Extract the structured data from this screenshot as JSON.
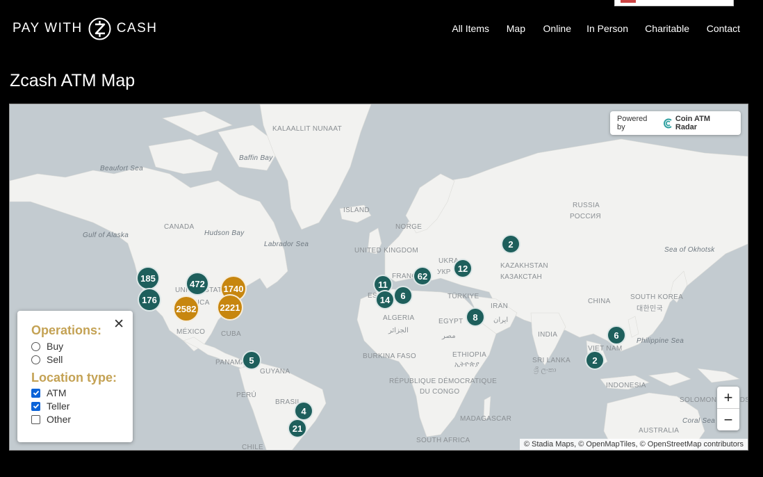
{
  "header": {
    "logo_left": "PAY WITH",
    "logo_right": "CASH",
    "nav": [
      {
        "label": "All Items"
      },
      {
        "label": "Map"
      },
      {
        "label": "Online"
      },
      {
        "label": "In Person"
      },
      {
        "label": "Charitable"
      },
      {
        "label": "Contact"
      }
    ]
  },
  "page": {
    "title": "Zcash ATM Map"
  },
  "map": {
    "powered_by": "Powered by",
    "provider": "Coin ATM Radar",
    "attribution": "© Stadia Maps, © OpenMapTiles, © OpenStreetMap contributors",
    "zoom_in": "+",
    "zoom_out": "−",
    "colors": {
      "cluster_teal": "#1e5f5c",
      "cluster_gold": "#c7860f",
      "water": "#c3cbd0",
      "land": "#f2f2f0"
    },
    "clusters": [
      {
        "count": "185",
        "color": "teal"
      },
      {
        "count": "176",
        "color": "teal"
      },
      {
        "count": "472",
        "color": "teal"
      },
      {
        "count": "1740",
        "color": "gold"
      },
      {
        "count": "2582",
        "color": "gold"
      },
      {
        "count": "2221",
        "color": "gold"
      },
      {
        "count": "5",
        "color": "teal"
      },
      {
        "count": "4",
        "color": "teal"
      },
      {
        "count": "21",
        "color": "teal"
      },
      {
        "count": "11",
        "color": "teal"
      },
      {
        "count": "14",
        "color": "teal"
      },
      {
        "count": "6",
        "color": "teal"
      },
      {
        "count": "62",
        "color": "teal"
      },
      {
        "count": "12",
        "color": "teal"
      },
      {
        "count": "2",
        "color": "teal"
      },
      {
        "count": "8",
        "color": "teal"
      },
      {
        "count": "6",
        "color": "teal"
      },
      {
        "count": "2",
        "color": "teal"
      }
    ],
    "labels": [
      "KALAALLIT NUNAAT",
      "Baffin Bay",
      "Beaufort Sea",
      "ISLAND",
      "CANADA",
      "Hudson Bay",
      "Gulf of Alaska",
      "Labrador Sea",
      "UNITED KINGDOM",
      "NORGE",
      "RUSSIA",
      "РОССИЯ",
      "Sea of Okhotsk",
      "KAZAKHSTAN",
      "КАЗАКСТАН",
      "UKRA",
      "УКР",
      "TÜRKIYE",
      "IRAN",
      "ایران",
      "CHINA",
      "SOUTH KOREA",
      "대한민국",
      "ALGERIA",
      "الجزائر",
      "EGYPT",
      "مصر",
      "INDIA",
      "VIET NAM",
      "Philippine Sea",
      "SRI LANKA",
      "ශ්‍රී ලංකා",
      "BURKINA FASO",
      "ETHIOPIA",
      "ኢትዮጵያ",
      "RÉPUBLIQUE DÉMOCRATIQUE",
      "DU CONGO",
      "MADAGASCAR",
      "SOUTH AFRICA",
      "INDONESIA",
      "AUSTRALIA",
      "Coral Sea",
      "SOLOMON ISLANDS",
      "MÉXICO",
      "CUBA",
      "PANAMÁ",
      "GUYANA",
      "PERÚ",
      "BRASIL",
      "CHILE",
      "UNITED STATES",
      "AMERICA",
      "FRANCE",
      "ES"
    ]
  },
  "filters": {
    "close": "✕",
    "operations_title": "Operations:",
    "operations": [
      {
        "label": "Buy",
        "checked": false
      },
      {
        "label": "Sell",
        "checked": false
      }
    ],
    "location_title": "Location type:",
    "location_types": [
      {
        "label": "ATM",
        "checked": true
      },
      {
        "label": "Teller",
        "checked": true
      },
      {
        "label": "Other",
        "checked": false
      }
    ]
  }
}
